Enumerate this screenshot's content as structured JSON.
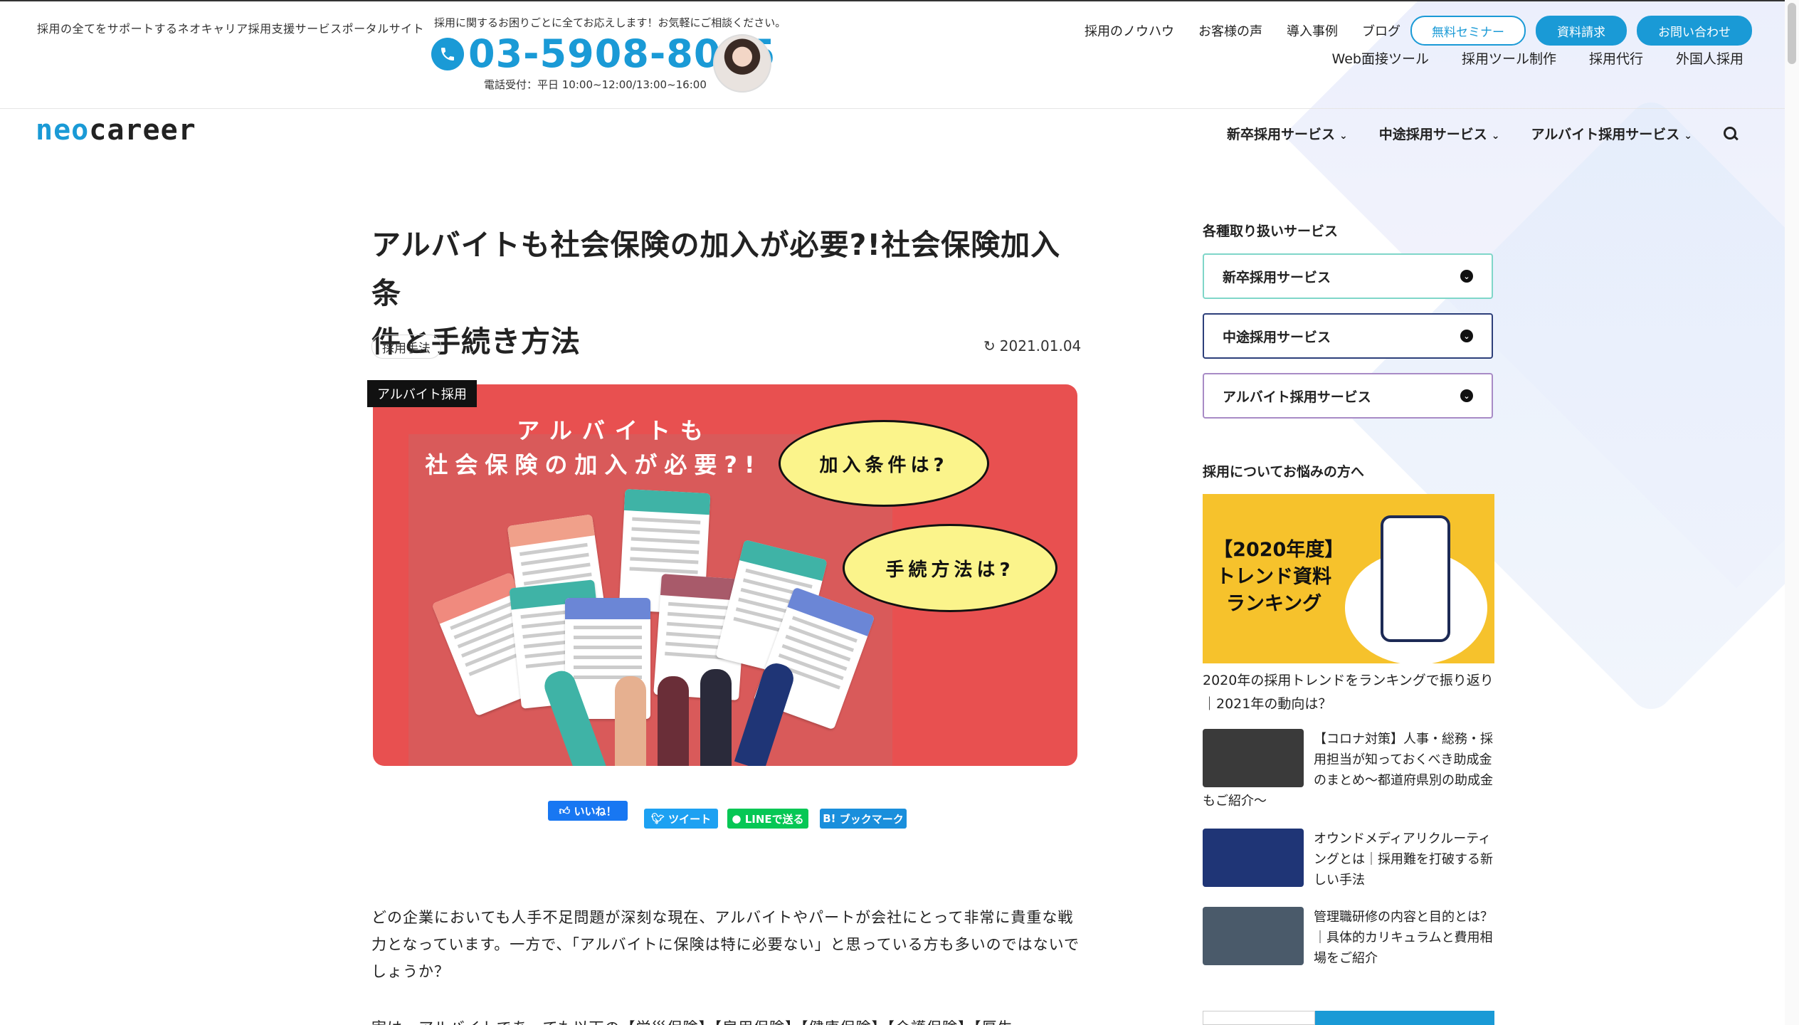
{
  "header": {
    "tagline": "採用の全てをサポートするネオキャリア採用支援サービスポータルサイト",
    "contact_note": "採用に関するお困りごとに全てお応えします！お気軽にご相談ください。",
    "phone": "03-5908-8005",
    "phone_hours": "電話受付：平日 10:00~12:00/13:00~16:00",
    "links_row1": [
      "採用のノウハウ",
      "お客様の声",
      "導入事例",
      "ブログ"
    ],
    "seminar": "無料セミナー",
    "request_docs": "資料請求",
    "contact": "お問い合わせ",
    "links_row2": [
      "Web面接ツール",
      "採用ツール制作",
      "採用代行",
      "外国人採用"
    ]
  },
  "nav": {
    "logo_neo": "neo",
    "logo_rest": "career",
    "items": [
      "新卒採用サービス",
      "中途採用サービス",
      "アルバイト採用サービス"
    ]
  },
  "article": {
    "title_line1": "アルバイトも社会保険の加入が必要?!社会保険加入条",
    "title_line2": "件と手続き方法",
    "category": "採用手法",
    "date": "2021.01.04",
    "hero_tag": "アルバイト採用",
    "hero_head1": "アルバイトも",
    "hero_head2": "社会保険の加入が必要?!",
    "bubble1": "加入条件は?",
    "bubble2": "手続方法は?",
    "share": {
      "like": "いいね！",
      "tweet": "ツイート",
      "line": "LINEで送る",
      "hatena": "ブックマーク"
    },
    "body": "どの企業においても人手不足問題が深刻な現在、アルバイトやパートが会社にとって非常に貴重な戦力となっています。一方で、「アルバイトに保険は特に必要ない」と思っている方も多いのではないでしょうか？",
    "body_cut": "実は、アルバイトであっても以下の【労災保険】【雇用保険】【健康保険】【介護保険】【厚生"
  },
  "sidebar": {
    "services_heading": "各種取り扱いサービス",
    "services": [
      "新卒採用サービス",
      "中途採用サービス",
      "アルバイト採用サービス"
    ],
    "services_colors": [
      "#7fd6c9",
      "#2d3f7a",
      "#a88bc6"
    ],
    "concerns_heading": "採用についてお悩みの方へ",
    "banner_text": "【2020年度】トレンド資料ランキング",
    "featured_caption": "2020年の採用トレンドをランキングで振り返り｜2021年の動向は？",
    "posts": [
      {
        "title": "【コロナ対策】人事・総務・採用担当が知っておくべき助成金のまとめ〜都道府県別の助成金もご紹介〜",
        "thumb_color": "#3a3a3a"
      },
      {
        "title": "オウンドメディアリクルーティングとは｜採用難を打破する新しい手法",
        "thumb_color": "#1f3576"
      },
      {
        "title": "管理職研修の内容と目的とは？｜具体的カリキュラムと費用相場をご紹介",
        "thumb_color": "#4a5a6a"
      }
    ]
  },
  "icons": {
    "phone": "phone-icon",
    "search": "search-icon",
    "refresh": "refresh-icon",
    "chevron": "chevron-down-icon"
  },
  "colors": {
    "brand": "#1a9ad6",
    "hero_bg": "#e85050",
    "bubble": "#fbf48b"
  }
}
